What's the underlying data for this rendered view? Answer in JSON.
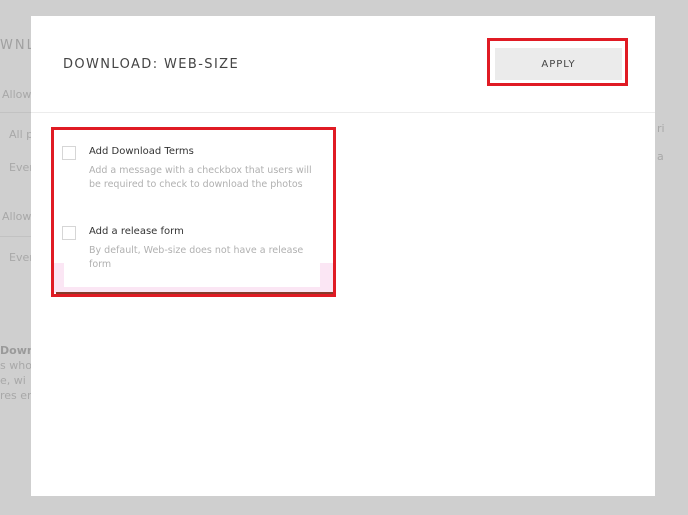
{
  "background": {
    "fragments": [
      "WNLO",
      "Allow",
      "All p",
      "Ever",
      "Allow",
      "Ever",
      "Downlo",
      "s who",
      "e, wi",
      "res en"
    ],
    "right_fragments": [
      "ri",
      "a"
    ]
  },
  "modal": {
    "title": "DOWNLOAD: WEB-SIZE",
    "apply_label": "APPLY",
    "options": [
      {
        "label": "Add Download Terms",
        "description": "Add a message with a checkbox that users will be required to check to download the photos",
        "checked": false
      },
      {
        "label": "Add a release form",
        "description": "By default, Web-size does not have a release form",
        "checked": false
      }
    ]
  },
  "colors": {
    "highlight": "#e01b24",
    "overlay": "#cfcfcf",
    "button_bg": "#ebebeb"
  }
}
